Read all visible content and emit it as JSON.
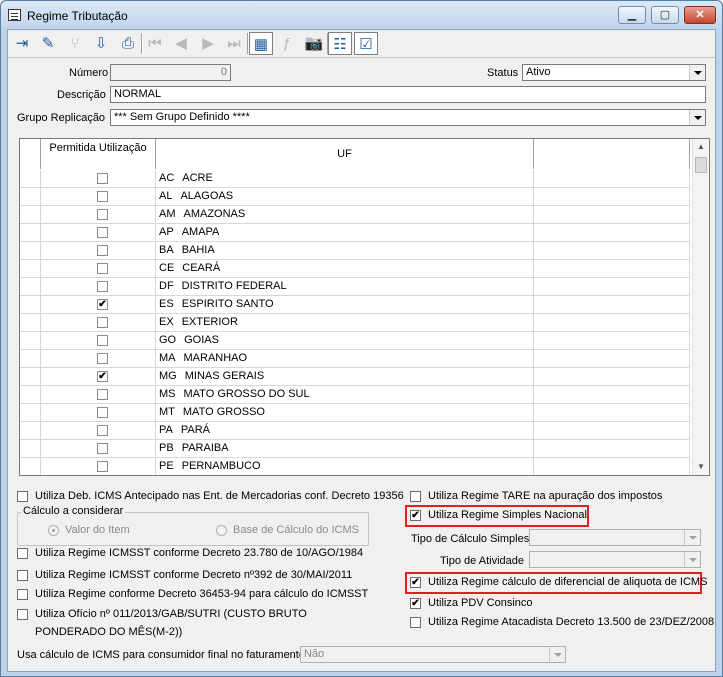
{
  "window": {
    "title": "Regime Tributação"
  },
  "toolbar": {
    "buttons": [
      {
        "icon": "exit-icon",
        "glyph": "⇥",
        "enabled": true
      },
      {
        "icon": "edit-icon",
        "glyph": "✎",
        "enabled": true
      },
      {
        "icon": "split-icon",
        "glyph": "⑂",
        "enabled": false
      },
      {
        "icon": "import-icon",
        "glyph": "⇩",
        "enabled": true
      },
      {
        "icon": "print-icon",
        "glyph": "⎙",
        "enabled": true
      },
      {
        "icon": "first-icon",
        "glyph": "⏮",
        "enabled": false
      },
      {
        "icon": "previous-icon",
        "glyph": "◀",
        "enabled": false
      },
      {
        "icon": "next-icon",
        "glyph": "▶",
        "enabled": false
      },
      {
        "icon": "last-icon",
        "glyph": "⏭",
        "enabled": false
      },
      {
        "icon": "grid-icon",
        "glyph": "▦",
        "enabled": true
      },
      {
        "icon": "function-icon",
        "glyph": "ƒ",
        "enabled": false
      },
      {
        "icon": "camera-icon",
        "glyph": "📷",
        "enabled": true
      },
      {
        "icon": "tree-icon",
        "glyph": "☷",
        "enabled": true
      },
      {
        "icon": "checklist-icon",
        "glyph": "☑",
        "enabled": true
      }
    ]
  },
  "form": {
    "numero_label": "Número",
    "numero_value": "0",
    "descricao_label": "Descrição",
    "descricao_value": "NORMAL",
    "grupo_label": "Grupo Replicação",
    "grupo_value": "*** Sem Grupo Definido ****",
    "status_label": "Status",
    "status_value": "Ativo"
  },
  "grid": {
    "col_permitida": "Permitida Utilização",
    "col_uf": "UF",
    "rows": [
      {
        "code": "AC",
        "name": "ACRE",
        "checked": false,
        "check_glyph": ""
      },
      {
        "code": "AL",
        "name": "ALAGOAS",
        "checked": false,
        "check_glyph": ""
      },
      {
        "code": "AM",
        "name": "AMAZONAS",
        "checked": false,
        "check_glyph": ""
      },
      {
        "code": "AP",
        "name": "AMAPA",
        "checked": false,
        "check_glyph": ""
      },
      {
        "code": "BA",
        "name": "BAHIA",
        "checked": false,
        "check_glyph": ""
      },
      {
        "code": "CE",
        "name": "CEARÁ",
        "checked": false,
        "check_glyph": ""
      },
      {
        "code": "DF",
        "name": "DISTRITO FEDERAL",
        "checked": false,
        "check_glyph": ""
      },
      {
        "code": "ES",
        "name": "ESPIRITO SANTO",
        "checked": true,
        "check_glyph": "✔"
      },
      {
        "code": "EX",
        "name": "EXTERIOR",
        "checked": false,
        "check_glyph": ""
      },
      {
        "code": "GO",
        "name": "GOIAS",
        "checked": false,
        "check_glyph": ""
      },
      {
        "code": "MA",
        "name": "MARANHAO",
        "checked": false,
        "check_glyph": ""
      },
      {
        "code": "MG",
        "name": "MINAS GERAIS",
        "checked": true,
        "check_glyph": "✔"
      },
      {
        "code": "MS",
        "name": "MATO GROSSO DO SUL",
        "checked": false,
        "check_glyph": ""
      },
      {
        "code": "MT",
        "name": "MATO GROSSO",
        "checked": false,
        "check_glyph": ""
      },
      {
        "code": "PA",
        "name": "PARÁ",
        "checked": false,
        "check_glyph": ""
      },
      {
        "code": "PB",
        "name": "PARAIBA",
        "checked": false,
        "check_glyph": ""
      },
      {
        "code": "PE",
        "name": "PERNAMBUCO",
        "checked": false,
        "check_glyph": ""
      }
    ]
  },
  "options": {
    "deb_icms_label": "Utiliza Deb. ICMS Antecipado nas Ent. de Mercadorias conf. Decreto 19356",
    "calculo_group_title": "Cálculo a considerar",
    "radio_valor_item": "Valor do Item",
    "radio_base_calculo": "Base de Cálculo do ICMS",
    "icmsst_23780_label": "Utiliza Regime ICMSST conforme Decreto 23.780 de 10/AGO/1984",
    "icmsst_392_label": "Utiliza Regime ICMSST conforme Decreto nº392 de 30/MAI/2011",
    "decreto_36453_label": "Utiliza Regime conforme Decreto 36453-94 para cálculo do ICMSST",
    "oficio_label_line1": "Utiliza Ofício nº 011/2013/GAB/SUTRI (CUSTO BRUTO",
    "oficio_label_line2": "PONDERADO DO MÊS(M-2))",
    "consumidor_final_label": "Usa cálculo de ICMS para consumidor final no faturamento",
    "consumidor_final_value": "Não",
    "tare_label": "Utiliza Regime TARE na apuração dos impostos",
    "simples_label": "Utiliza Regime Simples Nacional",
    "simples_check_glyph": "✔",
    "tipo_calculo_label": "Tipo de Cálculo Simples",
    "tipo_atividade_label": "Tipo de Atividade",
    "diferencial_label": "Utiliza Regime cálculo de diferencial de aliquota de ICMS",
    "diferencial_check_glyph": "✔",
    "pdv_label": "Utiliza PDV Consinco",
    "pdv_check_glyph": "✔",
    "atacadista_label": "Utiliza Regime Atacadista Decreto 13.500 de 23/DEZ/2008"
  },
  "colors": {
    "highlight": "#e02020",
    "check": "#000000"
  }
}
